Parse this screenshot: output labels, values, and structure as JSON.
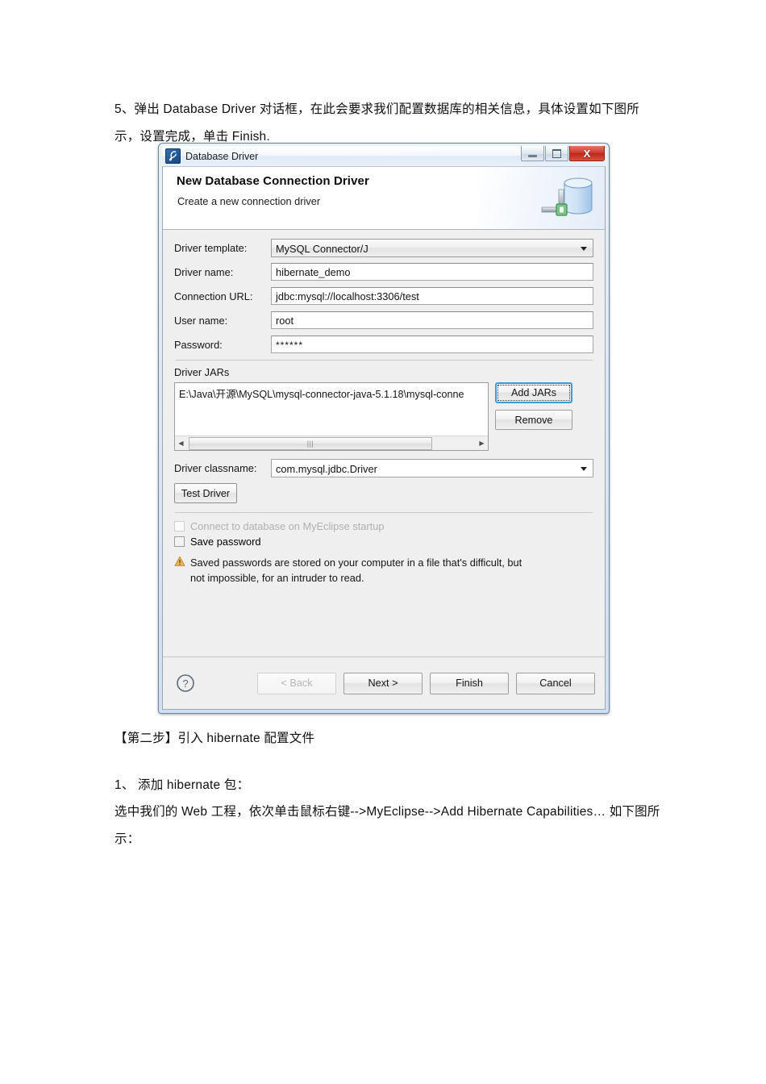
{
  "document": {
    "intro_paragraph": "5、弹出 Database Driver 对话框，在此会要求我们配置数据库的相关信息，具体设置如下图所示，设置完成，单击 Finish.",
    "step_two_heading": "【第二步】引入 hibernate 配置文件",
    "item_one": "1、 添加 hibernate 包：",
    "item_one_detail": "选中我们的 Web 工程，依次单击鼠标右键-->MyEclipse-->Add Hibernate Capabilities… 如下图所示："
  },
  "dialog": {
    "title": "Database Driver",
    "app_icon": "myeclipse-icon",
    "window_buttons": {
      "minimize": "minimize-icon",
      "maximize": "maximize-icon",
      "close": "X"
    },
    "header": {
      "title": "New Database Connection Driver",
      "subtitle": "Create a new connection driver",
      "icon": "database-cylinder-icon"
    },
    "fields": [
      {
        "label": "Driver template:",
        "value": "MySQL Connector/J",
        "kind": "combo"
      },
      {
        "label": "Driver name:",
        "value": "hibernate_demo",
        "kind": "text"
      },
      {
        "label": "Connection URL:",
        "value": "jdbc:mysql://localhost:3306/test",
        "kind": "text"
      },
      {
        "label": "User name:",
        "value": "root",
        "kind": "text"
      },
      {
        "label": "Password:",
        "value": "******",
        "kind": "password"
      }
    ],
    "driver_jars": {
      "section_label": "Driver JARs",
      "items": [
        "E:\\Java\\开源\\MySQL\\mysql-connector-java-5.1.18\\mysql-conne"
      ],
      "add_button": "Add JARs",
      "remove_button": "Remove",
      "scrollbar": {
        "left_arrow": "◀",
        "right_arrow": "▶",
        "grip": "|||"
      }
    },
    "driver_classname": {
      "label": "Driver classname:",
      "value": "com.mysql.jdbc.Driver"
    },
    "test_driver_button": "Test Driver",
    "checkboxes": [
      {
        "label": "Connect to database on MyEclipse startup",
        "checked": false,
        "enabled": false
      },
      {
        "label": "Save password",
        "checked": false,
        "enabled": true
      }
    ],
    "warning": {
      "icon": "warning-triangle-icon",
      "line1": "Saved passwords are stored on your computer in a file that's difficult, but",
      "line2": "not impossible, for an intruder to read."
    },
    "footer": {
      "help_icon": "help-question-icon",
      "back_button": "< Back",
      "next_button": "Next >",
      "finish_button": "Finish",
      "cancel_button": "Cancel",
      "back_enabled": false
    }
  },
  "colors": {
    "accent_blue": "#3f9bd6",
    "close_red": "#cf3a2c",
    "warning_amber": "#e8a33d",
    "dialog_bg": "#efefef",
    "field_bg": "#ffffff"
  }
}
